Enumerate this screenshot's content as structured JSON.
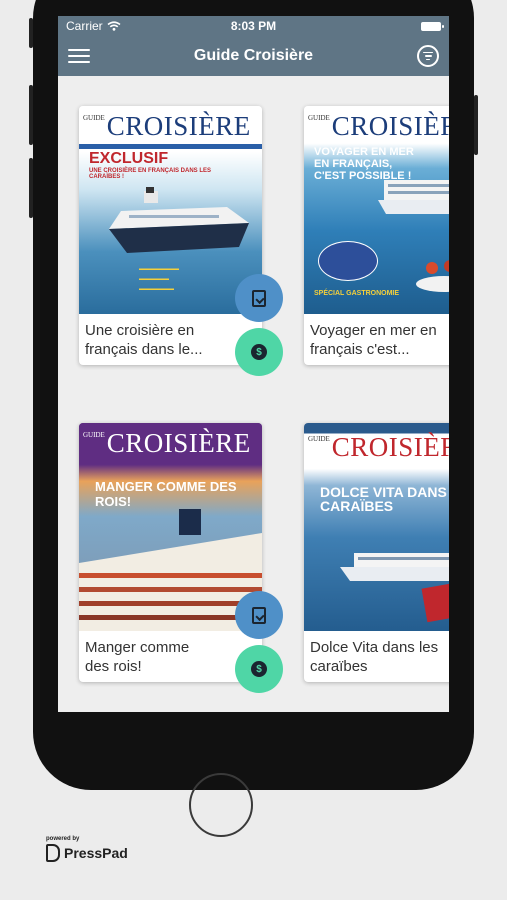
{
  "status_bar": {
    "carrier": "Carrier",
    "time": "8:03 PM"
  },
  "header": {
    "title": "Guide Croisière"
  },
  "icons": {
    "menu": "hamburger-icon",
    "filter": "filter-icon",
    "download": "document-download-icon",
    "buy": "dollar-coin-icon",
    "wifi": "wifi-icon",
    "battery": "battery-icon"
  },
  "colors": {
    "navbar": "#5f7585",
    "download_fab": "#4f90c8",
    "buy_fab": "#4fd6a6",
    "background": "#eeeeee"
  },
  "issues": [
    {
      "title": "Une croisière en français dans le...",
      "cover_masthead": "GUIDE CROISIÈRE",
      "cover_headline": "EXCLUSIF",
      "cover_subheadline": "UNE CROISIÈRE EN FRANÇAIS DANS LES CARAÏBES !"
    },
    {
      "title": "Voyager en mer en français c'est...",
      "cover_masthead": "GUIDE CROISIÈRE",
      "cover_headline": "VOYAGER EN MER EN FRANÇAIS, C'EST POSSIBLE !",
      "cover_subheadline": "SPÉCIAL GASTRONOMIE"
    },
    {
      "title": "Manger comme des rois!",
      "cover_masthead": "GUIDE CROISIÈRE",
      "cover_headline": "MANGER COMME DES ROIS!",
      "cover_subheadline": ""
    },
    {
      "title": "Dolce Vita dans les caraïbes",
      "cover_masthead": "GUIDE CROISIÈRE",
      "cover_headline": "DOLCE VITA DANS LES CARAÏBES",
      "cover_subheadline": ""
    }
  ],
  "footer": {
    "powered_by": "powered by",
    "brand": "PressPad"
  }
}
